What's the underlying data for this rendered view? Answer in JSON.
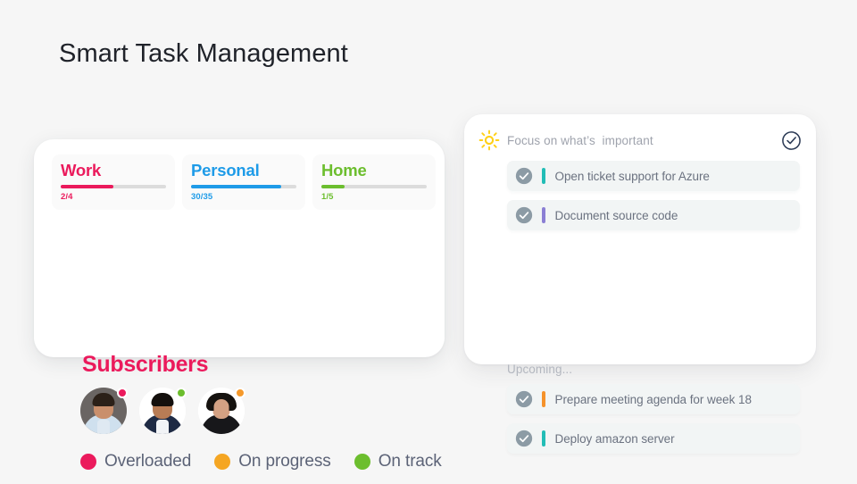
{
  "page": {
    "title": "Smart Task Management",
    "background_color": "#f6f6f6"
  },
  "left_card": {
    "categories": [
      {
        "name": "Work",
        "count": "2/4",
        "percent": 50,
        "color": "#eb1a5c",
        "track_color": "#dcdcdc"
      },
      {
        "name": "Personal",
        "count": "30/35",
        "percent": 86,
        "color": "#1e9be8",
        "track_color": "#dcdcdc"
      },
      {
        "name": "Home",
        "count": "1/5",
        "percent": 22,
        "color": "#6cbe2e",
        "track_color": "#dcdcdc"
      }
    ],
    "subscribers": {
      "title": "Subscribers",
      "title_color": "#eb1a5c",
      "avatars": [
        {
          "name": "avatar-1",
          "status_color": "#eb1a5c",
          "status": "Overloaded",
          "skin": "#c98f6c",
          "hair": "#2b2018",
          "bg": "#6a6563",
          "shirt": "#cfe0ee"
        },
        {
          "name": "avatar-2",
          "status_color": "#6cbe2e",
          "status": "On track",
          "skin": "#b87c55",
          "hair": "#14100d",
          "bg": "#ffffff",
          "shirt": "#1e2a44"
        },
        {
          "name": "avatar-3",
          "status_color": "#f5992b",
          "status": "On progress",
          "skin": "#d3a183",
          "hair": "#15120f",
          "bg": "#ffffff",
          "shirt": "#1a1a1a"
        }
      ]
    },
    "legend": [
      {
        "label": "Overloaded",
        "color": "#eb1a5c"
      },
      {
        "label": "On progress",
        "color": "#f5a623"
      },
      {
        "label": "On track",
        "color": "#6cbe2e"
      }
    ]
  },
  "right_card": {
    "header": {
      "icon": "sun-icon",
      "title": "Focus on what’s  important",
      "action_icon": "check-circle-outline-icon",
      "action_color": "#2b3a55"
    },
    "sections": [
      {
        "label": null,
        "tasks": [
          {
            "label": "Open ticket support for Azure",
            "bar_color": "#22bdb6",
            "checked": true
          },
          {
            "label": "Document source code",
            "bar_color": "#8b7fd4",
            "checked": true
          }
        ]
      },
      {
        "label": "Upcoming...",
        "tasks": [
          {
            "label": "Prepare meeting agenda for week 18",
            "bar_color": "#f5922b",
            "checked": true
          },
          {
            "label": "Deploy amazon server",
            "bar_color": "#22bdb6",
            "checked": true
          }
        ]
      }
    ],
    "check_fill_color": "#8c9ba5"
  }
}
